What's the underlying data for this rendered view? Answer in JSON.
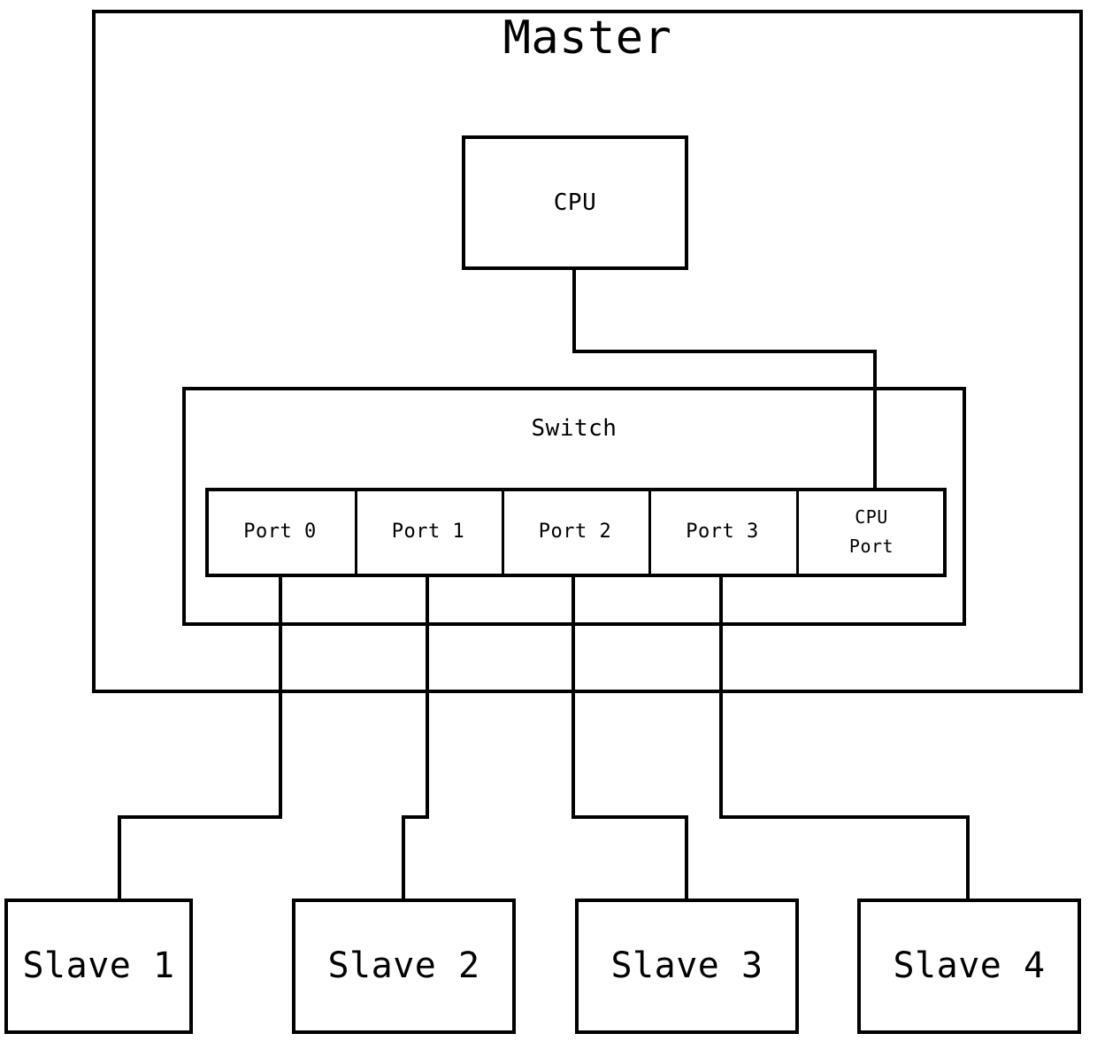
{
  "diagram": {
    "title": "Master",
    "type": "block-diagram",
    "description": "DSA switch topology: a Master device containing a CPU and an Ethernet Switch with four user ports plus a CPU port, each user port wired to one of four Slave devices."
  },
  "master": {
    "label": "Master"
  },
  "cpu": {
    "label": "CPU"
  },
  "switch": {
    "label": "Switch",
    "ports": [
      {
        "label": "Port 0",
        "id": "port-0"
      },
      {
        "label": "Port 1",
        "id": "port-1"
      },
      {
        "label": "Port 2",
        "id": "port-2"
      },
      {
        "label": "Port 3",
        "id": "port-3"
      }
    ],
    "cpu_port": {
      "line1": "CPU",
      "line2": "Port",
      "id": "cpu-port"
    }
  },
  "slaves": [
    {
      "label": "Slave 1",
      "id": "slave-1"
    },
    {
      "label": "Slave 2",
      "id": "slave-2"
    },
    {
      "label": "Slave 3",
      "id": "slave-3"
    },
    {
      "label": "Slave 4",
      "id": "slave-4"
    }
  ],
  "connections": [
    {
      "from": "cpu",
      "to": "cpu-port"
    },
    {
      "from": "port-0",
      "to": "slave-1"
    },
    {
      "from": "port-1",
      "to": "slave-2"
    },
    {
      "from": "port-2",
      "to": "slave-3"
    },
    {
      "from": "port-3",
      "to": "slave-4"
    }
  ],
  "colors": {
    "stroke": "#000000",
    "background": "#ffffff"
  }
}
